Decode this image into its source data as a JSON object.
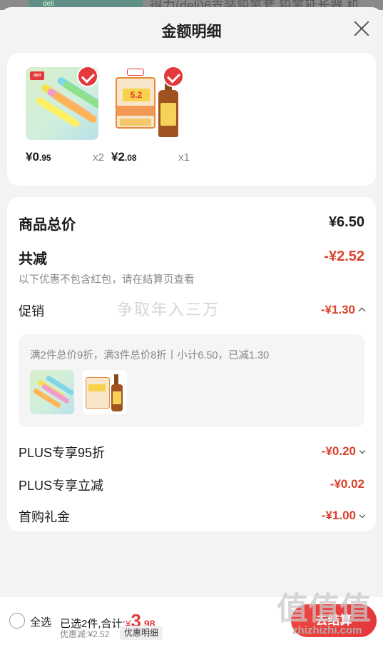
{
  "backdrop": {
    "logo_text": "deli",
    "title_text": "得力(deli)6支装铅笔套 铅笔延长器 机"
  },
  "sheet": {
    "title": "金额明细"
  },
  "products": [
    {
      "name": "pens",
      "logo_text": "deli",
      "price_main": "¥0",
      "price_decimal": ".95",
      "qty": "x2"
    },
    {
      "name": "cooking-wine",
      "box_text": "5.2",
      "price_main": "¥2",
      "price_decimal": ".08",
      "qty": "x1"
    }
  ],
  "detail": {
    "total_label": "商品总价",
    "total_value": "¥6.50",
    "reduce_label": "共减",
    "reduce_value": "-¥2.52",
    "reduce_note": "以下优惠不包含红包，请在结算页查看",
    "promo_label": "促销",
    "promo_value": "-¥1.30",
    "promo_text": "满2件总价9折，满3件总价8折丨小计6.50，已减1.30",
    "plus95_label": "PLUS专享95折",
    "plus95_value": "-¥0.20",
    "plus_off_label": "PLUS专享立减",
    "plus_off_value": "-¥0.02",
    "gift_label": "首购礼金",
    "gift_value": "-¥1.00"
  },
  "watermark": {
    "text": "争取年入三万"
  },
  "bottom": {
    "select_all": "全选",
    "selected_text": "已选2件,合计:",
    "currency": "¥",
    "total_int": "3",
    "total_dec": ".98",
    "discount_text": "优惠减:¥2.52",
    "detail_button": "优惠明细",
    "checkout_button": "去结算"
  },
  "site_mark": {
    "glyphs": "值值值",
    "site": "zhizhizhi.com"
  },
  "colors": {
    "accent_red": "#e4393c",
    "amount_red": "#d9422b"
  }
}
